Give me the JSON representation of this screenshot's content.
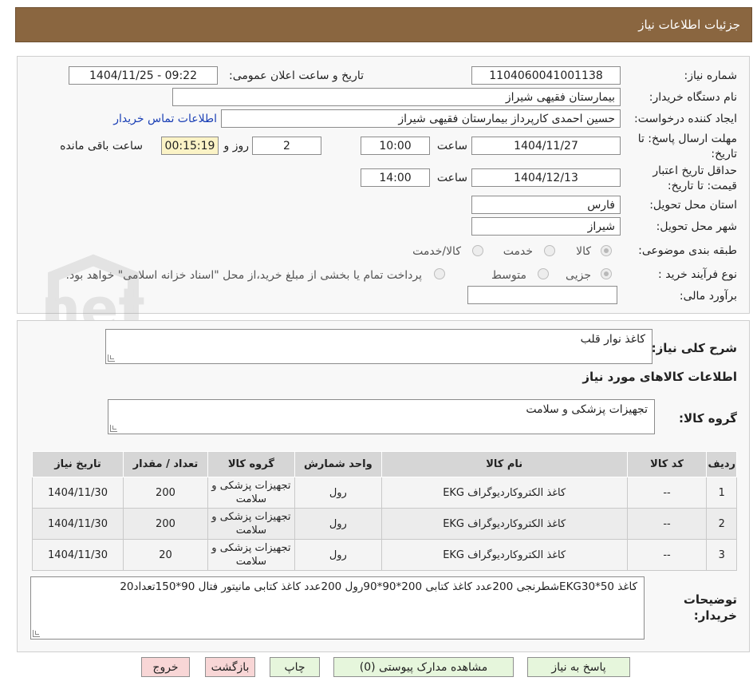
{
  "header": {
    "title": "جزئیات اطلاعات نیاز"
  },
  "watermark": {
    "text": "AriaTender.net"
  },
  "form": {
    "need_number_label": "شماره نیاز:",
    "need_number": "1104060041001138",
    "announce_label": "تاریخ و ساعت اعلان عمومی:",
    "announce_value": "1404/11/25 - 09:22",
    "buyer_org_label": "نام دستگاه خریدار:",
    "buyer_org": "بیمارستان فقیهی شیراز",
    "creator_label": "ایجاد کننده درخواست:",
    "creator": "حسین احمدی کارپرداز بیمارستان فقیهی شیراز",
    "contact_link": "اطلاعات تماس خریدار",
    "deadline_label_1": "مهلت ارسال پاسخ: تا",
    "deadline_label_2": "تاریخ:",
    "deadline_date": "1404/11/27",
    "time_label": "ساعت",
    "deadline_time": "10:00",
    "days_value": "2",
    "days_label": "روز و",
    "remaining_time": "00:15:19",
    "remaining_label": "ساعت باقی مانده",
    "validity_label_1": "حداقل تاریخ اعتبار",
    "validity_label_2": "قیمت: تا تاریخ:",
    "validity_date": "1404/12/13",
    "validity_time": "14:00",
    "province_label": "استان محل تحویل:",
    "province": "فارس",
    "city_label": "شهر محل تحویل:",
    "city": "شیراز",
    "category_label": "طبقه بندی موضوعی:",
    "category_options": [
      "کالا",
      "خدمت",
      "کالا/خدمت"
    ],
    "process_label": "نوع فرآیند خرید :",
    "process_options": [
      "جزیی",
      "متوسط"
    ],
    "process_note": "پرداخت تمام یا بخشی از مبلغ خرید،از محل \"اسناد خزانه اسلامی\" خواهد بود.",
    "estimate_label": "برآورد مالی:",
    "estimate_value": ""
  },
  "details": {
    "summary_label": "شرح کلی نیاز:",
    "summary_value": "کاغذ نوار قلب",
    "goods_info_title": "اطلاعات کالاهای مورد نیاز",
    "goods_group_label": "گروه کالا:",
    "goods_group_value": "تجهیزات پزشکی و سلامت",
    "table": {
      "headers": [
        "ردیف",
        "کد کالا",
        "نام کالا",
        "واحد شمارش",
        "گروه کالا",
        "تعداد / مقدار",
        "تاریخ نیاز"
      ],
      "rows": [
        [
          "1",
          "--",
          "کاغذ الکتروکاردیوگراف EKG",
          "رول",
          "تجهیزات پزشکی و سلامت",
          "200",
          "1404/11/30"
        ],
        [
          "2",
          "--",
          "کاغذ الکتروکاردیوگراف EKG",
          "رول",
          "تجهیزات پزشکی و سلامت",
          "200",
          "1404/11/30"
        ],
        [
          "3",
          "--",
          "کاغذ الکتروکاردیوگراف EKG",
          "رول",
          "تجهیزات پزشکی و سلامت",
          "20",
          "1404/11/30"
        ]
      ]
    },
    "buyer_notes_label_1": "توضیحات",
    "buyer_notes_label_2": "خریدار:",
    "buyer_notes_value": "کاغذ 50*EKG30شطرنجی 200عدد کاغذ کتابی 200*90*90رول 200عدد کاغذ کتابی مانیتور فتال 90*150تعداد20"
  },
  "buttons": {
    "reply": "پاسخ به نیاز",
    "attachments": "مشاهده مدارک پیوستی (0)",
    "print": "چاپ",
    "back": "بازگشت",
    "exit": "خروج"
  }
}
